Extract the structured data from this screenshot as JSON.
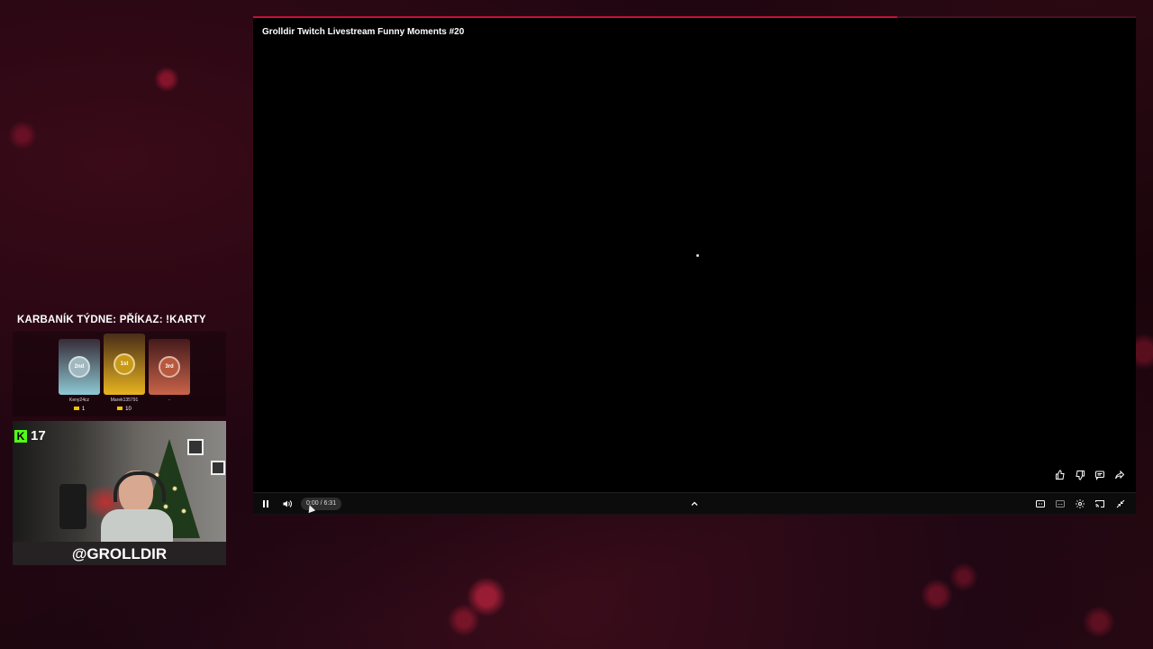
{
  "player": {
    "title": "Grolldir Twitch Livestream Funny Moments #20",
    "time": "0:00 / 6:31",
    "actions": [
      "like-icon",
      "dislike-icon",
      "comment-icon",
      "share-icon"
    ],
    "controls_right": [
      "hd-quality-icon",
      "subtitles-icon",
      "settings-icon",
      "cast-icon",
      "exit-fullscreen-icon"
    ],
    "accent_color": "#c5103a"
  },
  "overlay": {
    "leaderboard_title": "KARBANÍK TÝDNE: PŘÍKAZ: !KARTY",
    "places": [
      {
        "badge": "2nd",
        "name": "Keny24cz",
        "coins": "1"
      },
      {
        "badge": "1st",
        "name": "Marek135791",
        "coins": "10"
      },
      {
        "badge": "3rd",
        "name": "-",
        "coins": ""
      }
    ],
    "viewer_count": "17",
    "handle": "@GROLLDIR"
  }
}
